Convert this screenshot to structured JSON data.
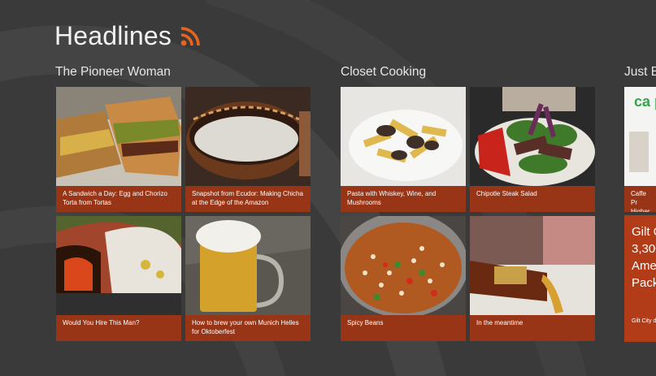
{
  "header": {
    "title": "Headlines",
    "feed_icon": "rss-icon"
  },
  "colors": {
    "background": "#3a3a3a",
    "caption": "#983516",
    "accent": "#e8641e"
  },
  "groups": [
    {
      "title": "The Pioneer Woman",
      "items": [
        {
          "caption": "A Sandwich a Day: Egg and Chorizo Torta from Tortas",
          "image": "sandwich-photo"
        },
        {
          "caption": "Snapshot from Ecudor: Making Chicha at the Edge of the Amazon",
          "image": "chicha-bowl-photo"
        },
        {
          "caption": "Would You Hire This Man?",
          "image": "pizza-oven-photo"
        },
        {
          "caption": "How to brew your own Munich Helles for Oktoberfest",
          "image": "beer-mug-photo"
        }
      ]
    },
    {
      "title": "Closet Cooking",
      "items": [
        {
          "caption": "Pasta with Whiskey, Wine, and Mushrooms",
          "image": "pasta-photo"
        },
        {
          "caption": "Chipotle Steak Salad",
          "image": "steak-salad-photo"
        },
        {
          "caption": "Spicy Beans",
          "image": "beans-pot-photo"
        },
        {
          "caption": "In the meantime",
          "image": "beer-pour-photo"
        }
      ]
    },
    {
      "title": "Just B",
      "items": [
        {
          "caption": "Caffe Pr Higher c",
          "image": "magazine-cover-photo",
          "image_text": "ca pro"
        },
        {
          "caption": "Gilt City deals on",
          "headline": "Gilt C\n3,300\nAme\nPack"
        }
      ]
    }
  ]
}
